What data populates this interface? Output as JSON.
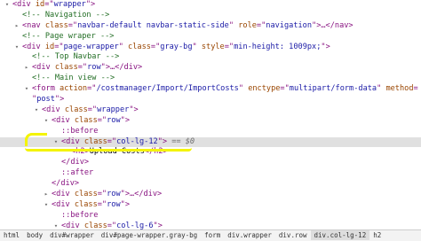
{
  "dom_lines": [
    {
      "arrow": "▾",
      "indent": 0,
      "parts": [
        [
          "tag",
          "<div "
        ],
        [
          "attr-name",
          "id"
        ],
        [
          "tag",
          "=\""
        ],
        [
          "attr-val",
          "wrapper"
        ],
        [
          "tag",
          "\">"
        ]
      ]
    },
    {
      "arrow": "",
      "indent": 1,
      "parts": [
        [
          "comment",
          "<!-- Navigation -->"
        ]
      ]
    },
    {
      "arrow": "▸",
      "indent": 1,
      "parts": [
        [
          "tag",
          "<nav "
        ],
        [
          "attr-name",
          "class"
        ],
        [
          "tag",
          "=\""
        ],
        [
          "attr-val",
          "navbar-default navbar-static-side"
        ],
        [
          "tag",
          "\" "
        ],
        [
          "attr-name",
          "role"
        ],
        [
          "tag",
          "=\""
        ],
        [
          "attr-val",
          "navigation"
        ],
        [
          "tag",
          "\">…</nav>"
        ]
      ]
    },
    {
      "arrow": "",
      "indent": 1,
      "parts": [
        [
          "comment",
          "<!-- Page wraper -->"
        ]
      ]
    },
    {
      "arrow": "▾",
      "indent": 1,
      "parts": [
        [
          "tag",
          "<div "
        ],
        [
          "attr-name",
          "id"
        ],
        [
          "tag",
          "=\""
        ],
        [
          "attr-val",
          "page-wrapper"
        ],
        [
          "tag",
          "\" "
        ],
        [
          "attr-name",
          "class"
        ],
        [
          "tag",
          "=\""
        ],
        [
          "attr-val",
          "gray-bg"
        ],
        [
          "tag",
          "\" "
        ],
        [
          "attr-name",
          "style"
        ],
        [
          "tag",
          "=\""
        ],
        [
          "attr-val",
          "min-height: 1009px;"
        ],
        [
          "tag",
          "\">"
        ]
      ]
    },
    {
      "arrow": "",
      "indent": 2,
      "parts": [
        [
          "comment",
          "<!-- Top Navbar -->"
        ]
      ]
    },
    {
      "arrow": "▸",
      "indent": 2,
      "parts": [
        [
          "tag",
          "<div "
        ],
        [
          "attr-name",
          "class"
        ],
        [
          "tag",
          "=\""
        ],
        [
          "attr-val",
          "row"
        ],
        [
          "tag",
          "\">…</div>"
        ]
      ]
    },
    {
      "arrow": "",
      "indent": 2,
      "parts": [
        [
          "comment",
          "<!-- Main view -->"
        ]
      ]
    },
    {
      "arrow": "▾",
      "indent": 2,
      "parts": [
        [
          "tag",
          "<form "
        ],
        [
          "attr-name",
          "action"
        ],
        [
          "tag",
          "=\""
        ],
        [
          "attr-val",
          "/costmanager/Import/ImportCosts"
        ],
        [
          "tag",
          "\" "
        ],
        [
          "attr-name",
          "enctype"
        ],
        [
          "tag",
          "=\""
        ],
        [
          "attr-val",
          "multipart/form-data"
        ],
        [
          "tag",
          "\" "
        ],
        [
          "attr-name",
          "method"
        ],
        [
          "tag",
          "="
        ]
      ]
    },
    {
      "arrow": "",
      "indent": 2,
      "parts": [
        [
          "tag",
          "\""
        ],
        [
          "attr-val",
          "post"
        ],
        [
          "tag",
          "\">"
        ]
      ]
    },
    {
      "arrow": "▾",
      "indent": 3,
      "parts": [
        [
          "tag",
          "<div "
        ],
        [
          "attr-name",
          "class"
        ],
        [
          "tag",
          "=\""
        ],
        [
          "attr-val",
          "wrapper"
        ],
        [
          "tag",
          "\">"
        ]
      ]
    },
    {
      "arrow": "▾",
      "indent": 4,
      "parts": [
        [
          "tag",
          "<div "
        ],
        [
          "attr-name",
          "class"
        ],
        [
          "tag",
          "=\""
        ],
        [
          "attr-val",
          "row"
        ],
        [
          "tag",
          "\">"
        ]
      ]
    },
    {
      "arrow": "",
      "indent": 5,
      "parts": [
        [
          "pseudo",
          "::before"
        ]
      ]
    },
    {
      "arrow": "▾",
      "indent": 5,
      "selected": true,
      "parts": [
        [
          "tag",
          "<div "
        ],
        [
          "attr-name",
          "class"
        ],
        [
          "tag",
          "=\""
        ],
        [
          "attr-val",
          "col-lg-12"
        ],
        [
          "tag",
          "\">"
        ],
        [
          "dollar",
          " == $0"
        ]
      ]
    },
    {
      "arrow": "",
      "indent": 6,
      "parts": [
        [
          "tag",
          "<h2>"
        ],
        [
          "text",
          "Upload Costs"
        ],
        [
          "tag",
          "</h2>"
        ]
      ]
    },
    {
      "arrow": "",
      "indent": 5,
      "parts": [
        [
          "tag",
          "</div>"
        ]
      ]
    },
    {
      "arrow": "",
      "indent": 5,
      "parts": [
        [
          "pseudo",
          "::after"
        ]
      ]
    },
    {
      "arrow": "",
      "indent": 4,
      "parts": [
        [
          "tag",
          "</div>"
        ]
      ]
    },
    {
      "arrow": "▸",
      "indent": 4,
      "parts": [
        [
          "tag",
          "<div "
        ],
        [
          "attr-name",
          "class"
        ],
        [
          "tag",
          "=\""
        ],
        [
          "attr-val",
          "row"
        ],
        [
          "tag",
          "\">…</div>"
        ]
      ]
    },
    {
      "arrow": "▾",
      "indent": 4,
      "parts": [
        [
          "tag",
          "<div "
        ],
        [
          "attr-name",
          "class"
        ],
        [
          "tag",
          "=\""
        ],
        [
          "attr-val",
          "row"
        ],
        [
          "tag",
          "\">"
        ]
      ]
    },
    {
      "arrow": "",
      "indent": 5,
      "parts": [
        [
          "pseudo",
          "::before"
        ]
      ]
    },
    {
      "arrow": "▾",
      "indent": 5,
      "parts": [
        [
          "tag",
          "<div "
        ],
        [
          "attr-name",
          "class"
        ],
        [
          "tag",
          "=\""
        ],
        [
          "attr-val",
          "col-lg-6"
        ],
        [
          "tag",
          "\">"
        ]
      ]
    }
  ],
  "breadcrumbs": [
    "html",
    "body",
    "div#wrapper",
    "div#page-wrapper.gray-bg",
    "form",
    "div.wrapper",
    "div.row",
    "div.col-lg-12",
    "h2"
  ],
  "breadcrumb_active_index": 7,
  "colors": {
    "highlight": "#f4f400",
    "selected_row": "#e0e0e0"
  }
}
